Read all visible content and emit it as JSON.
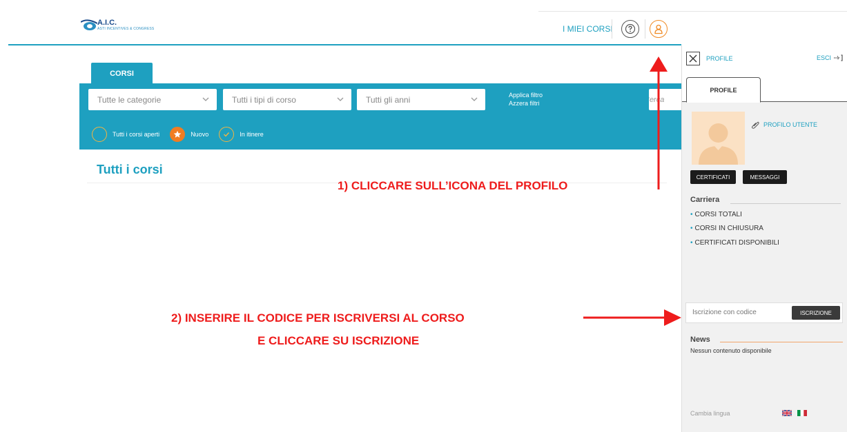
{
  "header": {
    "logo_name": "A.I.C.",
    "logo_sub": "ASTI INCENTIVES & CONGRESS",
    "nav_my_courses": "I MIEI CORSI"
  },
  "courses": {
    "tab_label": "CORSI",
    "filters": {
      "category": "Tutte le categorie",
      "type": "Tutti i tipi di corso",
      "year": "Tutti gli anni",
      "apply": "Applica filtro",
      "reset": "Azzera filtri",
      "search_placeholder": "Cerca"
    },
    "statuses": [
      {
        "label": "Tutti i corsi aperti",
        "icon": "open-circle-icon"
      },
      {
        "label": "Nuovo",
        "icon": "star-icon"
      },
      {
        "label": "In itinere",
        "icon": "check-icon"
      }
    ],
    "heading": "Tutti i corsi"
  },
  "annotations": {
    "step1": "1) CLICCARE SULL’ICONA DEL PROFILO",
    "step2_line1": "2) INSERIRE IL CODICE PER ISCRIVERSI AL CORSO",
    "step2_line2": "E CLICCARE SU ISCRIZIONE"
  },
  "drawer": {
    "title_link": "PROFILE",
    "logout": "ESCI",
    "tab": "PROFILE",
    "user_profile_link": "PROFILO UTENTE",
    "certificates_btn": "CERTIFICATI",
    "messages_btn": "MESSAGGI",
    "career_title": "Carriera",
    "career_items": [
      "CORSI TOTALI",
      "CORSI IN CHIUSURA",
      "CERTIFICATI DISPONIBILI"
    ],
    "enroll_placeholder": "Iscrizione con codice",
    "enroll_btn": "ISCRIZIONE",
    "news_title": "News",
    "news_empty": "Nessun contenuto disponibile",
    "language_label": "Cambia lingua"
  },
  "colors": {
    "primary": "#1ea0c0",
    "accent": "#f07d22",
    "annotation": "#ee1c1c"
  }
}
